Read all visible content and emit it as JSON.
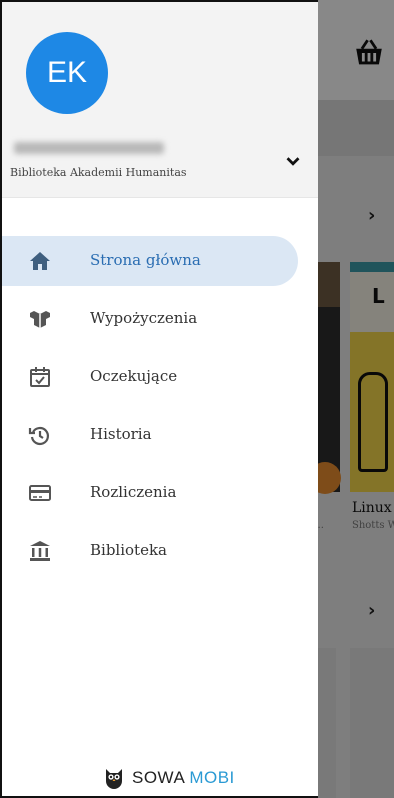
{
  "background": {
    "more_glyph": "⁝",
    "book": {
      "title": "Linux",
      "author": "Shotts W",
      "other_author_fragment": "9..."
    }
  },
  "drawer": {
    "avatar_initials": "EK",
    "library_name": "Biblioteka Akademii Humanitas",
    "menu": [
      {
        "label": "Strona główna",
        "icon": "home-icon",
        "active": true
      },
      {
        "label": "Wypożyczenia",
        "icon": "books-icon",
        "active": false
      },
      {
        "label": "Oczekujące",
        "icon": "calendar-check-icon",
        "active": false
      },
      {
        "label": "Historia",
        "icon": "history-icon",
        "active": false
      },
      {
        "label": "Rozliczenia",
        "icon": "credit-card-icon",
        "active": false
      },
      {
        "label": "Biblioteka",
        "icon": "library-icon",
        "active": false
      }
    ],
    "brand": {
      "part1": "SOWA",
      "part2": "MOBI"
    }
  },
  "colors": {
    "accent": "#1e88e5",
    "active_bg": "#dbe7f4",
    "active_text": "#2a6db2",
    "icon": "#444444",
    "brand_blue": "#2a9ad4"
  }
}
